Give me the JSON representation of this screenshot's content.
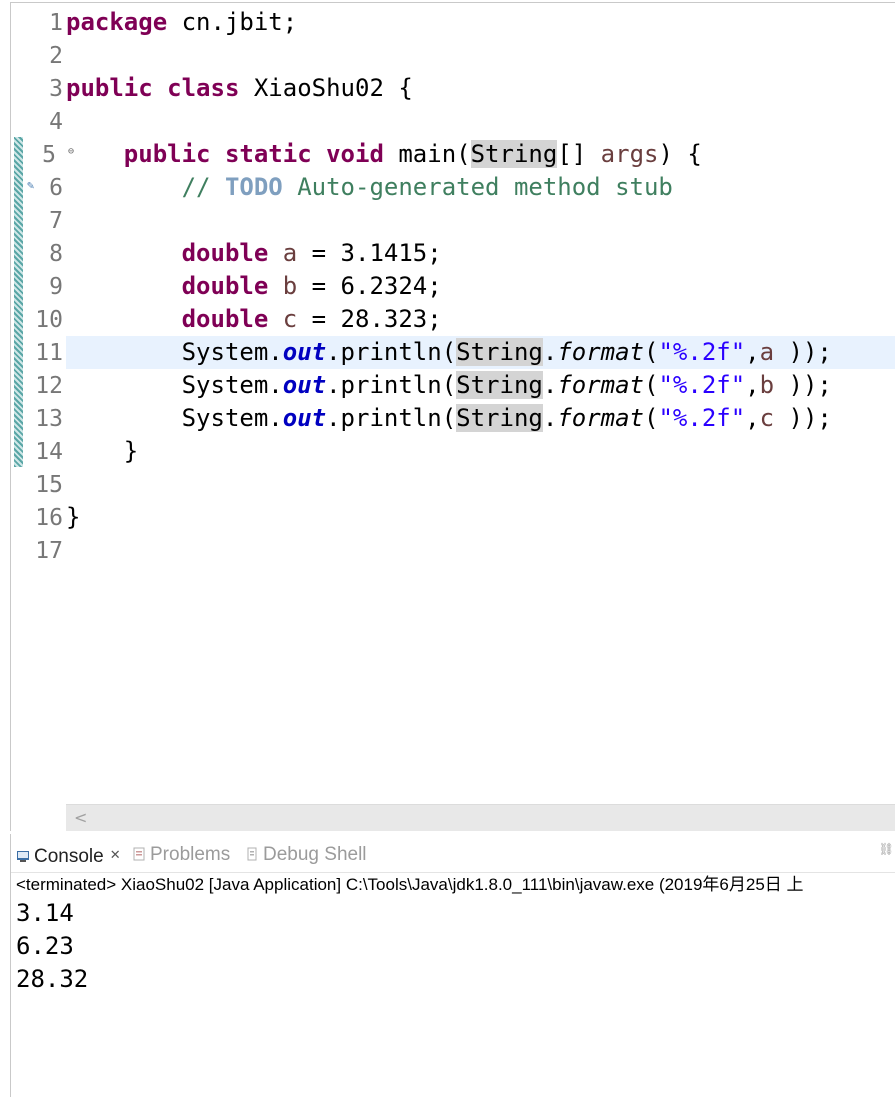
{
  "editor": {
    "line_numbers": [
      "1",
      "2",
      "3",
      "4",
      "5",
      "6",
      "7",
      "8",
      "9",
      "10",
      "11",
      "12",
      "13",
      "14",
      "15",
      "16",
      "17"
    ],
    "fold_marker": "⊖",
    "code": {
      "l1_kw": "package",
      "l1_rest": " cn.jbit;",
      "l3_kw1": "public",
      "l3_kw2": "class",
      "l3_rest": " XiaoShu02 {",
      "l5_kw1": "public",
      "l5_kw2": "static",
      "l5_kw3": "void",
      "l5_method": " main(",
      "l5_string": "String",
      "l5_mid": "[] ",
      "l5_args": "args",
      "l5_end": ") {",
      "l6_comment": "// ",
      "l6_todo": "TODO",
      "l6_rest": " Auto-generated method stub",
      "l8_kw": "double",
      "l8_var": "a",
      "l8_rest": " = 3.1415;",
      "l9_kw": "double",
      "l9_var": "b",
      "l9_rest": " = 6.2324;",
      "l10_kw": "double",
      "l10_var": "c",
      "l10_rest": " = 28.323;",
      "system": "System.",
      "out": "out",
      "println": ".println(",
      "string": "String",
      "dot": ".",
      "format": "format",
      "paren": "(",
      "fmt_str": "\"%.2f\"",
      "comma": ",",
      "l11_var": "a",
      "l12_var": "b",
      "l13_var": "c",
      "close": " ));",
      "l14": "}",
      "l16": "}"
    }
  },
  "console": {
    "tabs": {
      "console": "Console",
      "problems": "Problems",
      "debug_shell": "Debug Shell"
    },
    "close_glyph": "✕",
    "status": "<terminated> XiaoShu02 [Java Application] C:\\Tools\\Java\\jdk1.8.0_111\\bin\\javaw.exe (2019年6月25日 上",
    "output": [
      "3.14",
      "6.23",
      "28.32"
    ]
  },
  "colors": {
    "keyword": "#7f0055",
    "static_field": "#0000c0",
    "string_literal": "#2a00ff",
    "comment": "#3f7f5f",
    "todo": "#7f9fbf",
    "current_line": "#e8f2fe",
    "occurrence_highlight": "#d4d4d4"
  }
}
